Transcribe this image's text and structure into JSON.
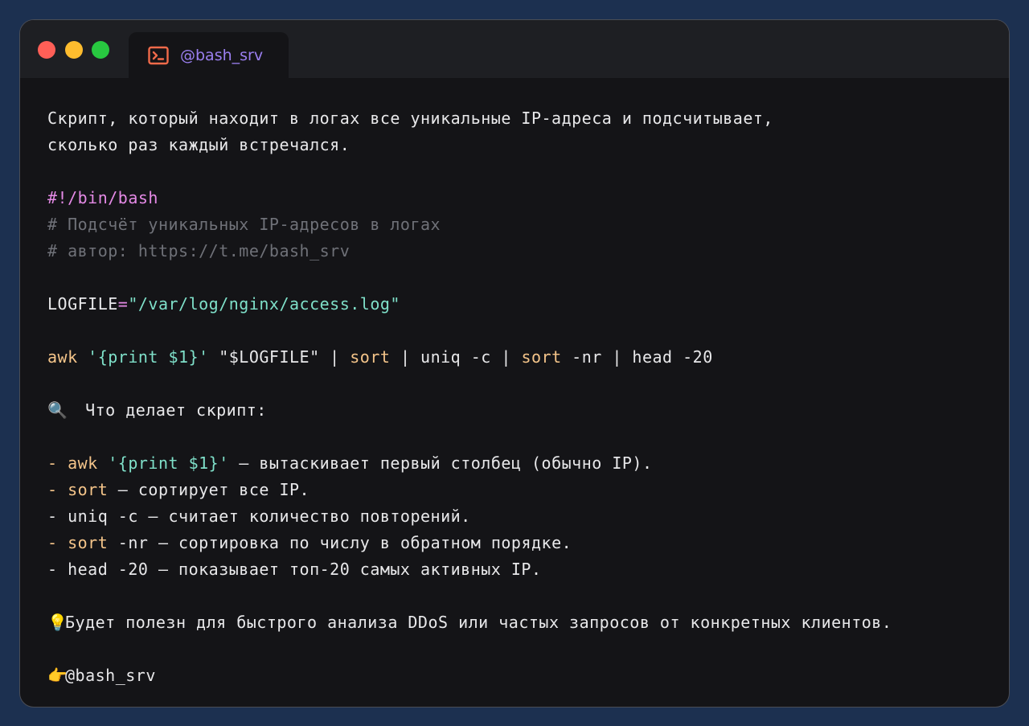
{
  "window": {
    "tab_label": "@bash_srv",
    "tab_icon": "terminal-icon"
  },
  "content": {
    "intro_line1": "Скрипт, который находит в логах все уникальные IP-адреса и подсчитывает,",
    "intro_line2": "сколько раз каждый встречался.",
    "shebang": "#!/bin/bash",
    "comment1": "# Подсчёт уникальных IP-адресов в логах",
    "comment2": "# автор: https://t.me/bash_srv",
    "logfile_var": "LOGFILE",
    "logfile_eq": "=",
    "logfile_value": "\"/var/log/nginx/access.log\"",
    "cmd": {
      "awk": "awk",
      "awk_arg": " '{print $1}'",
      "logfile_ref": " \"$LOGFILE\" | ",
      "sort1": "sort",
      "uniq": " | uniq -c | ",
      "sort2": "sort",
      "tail": " -nr | head -20"
    },
    "what_icon": "magnifier-icon",
    "what_heading": "Что делает скрипт:",
    "bullets": {
      "b1_dash": "- ",
      "b1_awk": "awk",
      "b1_arg": " '{print $1}'",
      "b1_text": " — вытаскивает первый столбец (обычно IP).",
      "b2_dash": "- ",
      "b2_sort": "sort",
      "b2_text": " — сортирует все IP.",
      "b3_text": "- uniq -c — считает количество повторений.",
      "b4_dash": "- ",
      "b4_sort": "sort",
      "b4_text": " -nr — сортировка по числу в обратном порядке.",
      "b5_text": "- head -20 — показывает топ-20 самых активных IP."
    },
    "tip_icon": "lightbulb-icon",
    "tip_text": "Будет полезн для быстрого анализа DDoS или частых запросов от конкретных клиентов.",
    "footer_icon": "pointing-hand-icon",
    "footer_text": "@bash_srv"
  },
  "colors": {
    "background": "#1c3050",
    "window": "#141417",
    "titlebar": "#1e1f23",
    "tab_text": "#9b7ff0",
    "keyword_orange": "#f5c58a",
    "string_teal": "#7fe0c9",
    "shebang_pink": "#e58ae6",
    "comment_gray": "#6f7178"
  }
}
